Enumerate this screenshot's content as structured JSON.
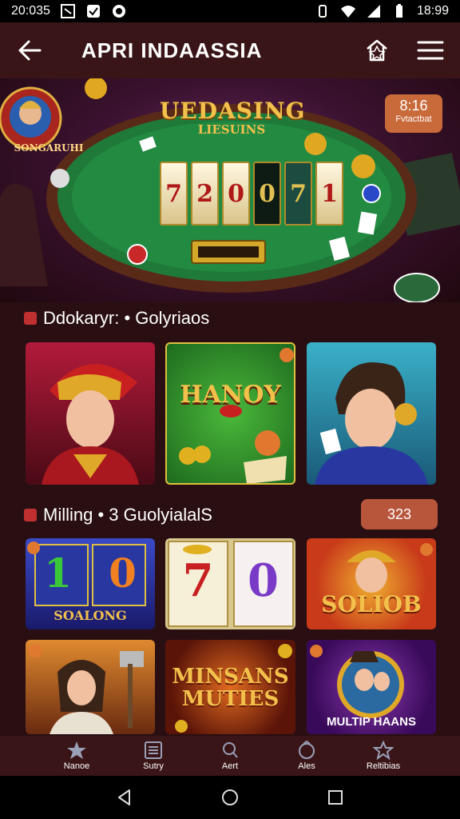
{
  "status_bar": {
    "time": "20:035",
    "right_time": "18:99",
    "icons": [
      "notification-icon",
      "check-icon",
      "sync-icon",
      "vibrate-icon",
      "wifi-icon",
      "signal-icon",
      "battery-icon"
    ]
  },
  "app_bar": {
    "title": "APRI INDAASSIA",
    "icons": [
      "back-arrow-icon",
      "share-icon",
      "menu-icon"
    ]
  },
  "hero": {
    "avatar_caption": "SONGARUHI",
    "timer_time": "8:16",
    "timer_label": "Fvtactbat",
    "title_line1": "UEDASING",
    "title_line2": "LIESUINS",
    "reels": [
      "7",
      "2",
      "0",
      "0",
      "7",
      "1"
    ]
  },
  "section1": {
    "title": "Ddokaryr: • Golyriaos",
    "tiles": [
      {
        "label": ""
      },
      {
        "label": "HANOY"
      },
      {
        "label": ""
      }
    ]
  },
  "section2": {
    "title": "Milling • 3 GuolyialalS",
    "count": "323",
    "tiles_row1": [
      {
        "label": "SOALONG",
        "reel_a": "1",
        "reel_b": "0"
      },
      {
        "label": "",
        "reel_a": "7",
        "reel_b": "0"
      },
      {
        "label": "SOLIOB"
      }
    ],
    "tiles_row2": [
      {
        "label": ""
      },
      {
        "label": "MINSANS MUTIES"
      },
      {
        "label": "MULTIP HAANS"
      }
    ]
  },
  "bottom_nav": [
    {
      "label": "Nanoe",
      "icon": "star-icon"
    },
    {
      "label": "Sutry",
      "icon": "list-icon"
    },
    {
      "label": "Aert",
      "icon": "search-icon"
    },
    {
      "label": "Ales",
      "icon": "heart-icon"
    },
    {
      "label": "Reltibias",
      "icon": "trophy-icon"
    }
  ],
  "colors": {
    "background": "#2a0f12",
    "app_bar": "#3a1517",
    "accent": "#c86a3a",
    "gold": "#f3c14b"
  }
}
